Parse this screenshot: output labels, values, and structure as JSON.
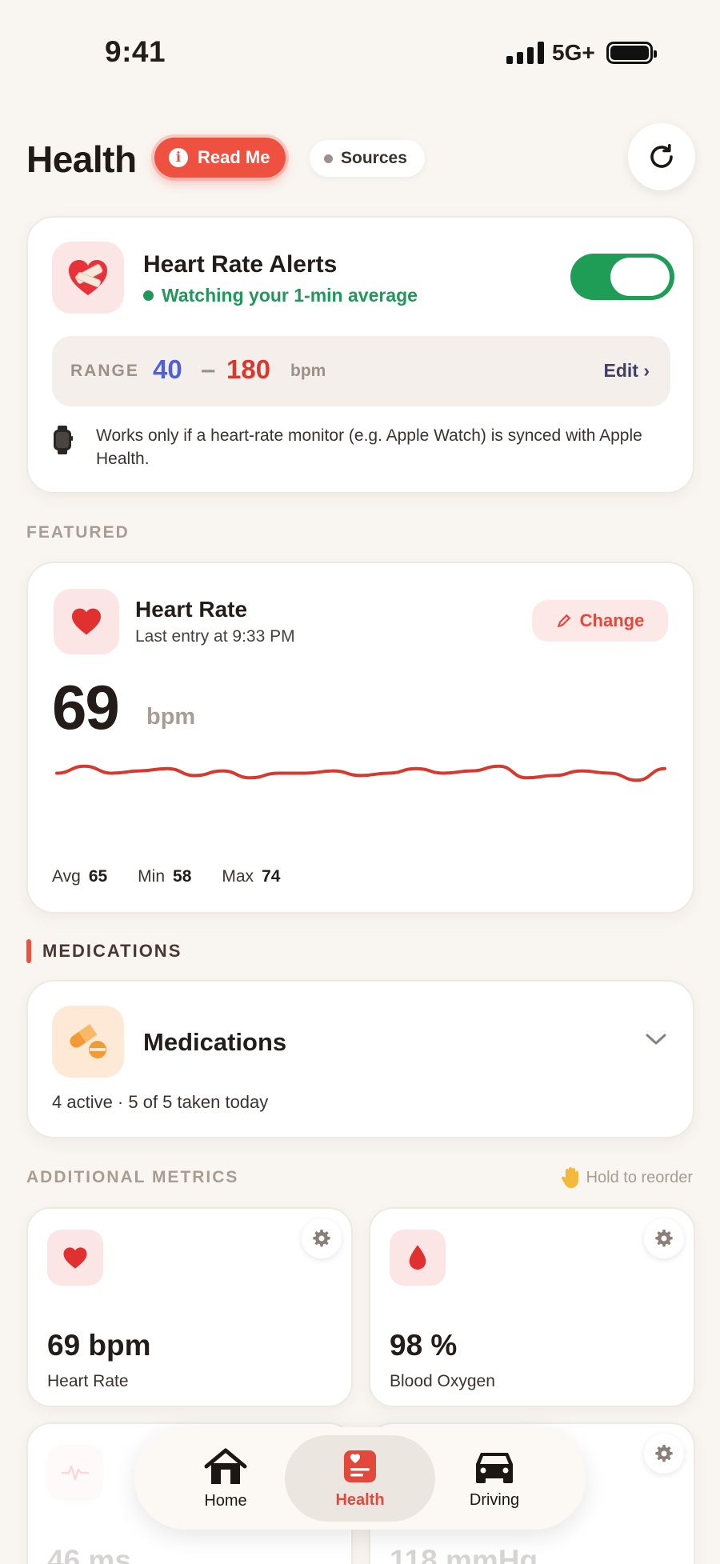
{
  "status_bar": {
    "time": "9:41",
    "network": "5G+"
  },
  "header": {
    "title": "Health",
    "readme_label": "Read Me",
    "sources_label": "Sources"
  },
  "alerts": {
    "title": "Heart Rate Alerts",
    "status": "Watching your 1-min average",
    "enabled": true,
    "range_label": "RANGE",
    "range_min": "40",
    "range_separator": "–",
    "range_max": "180",
    "range_unit": "bpm",
    "edit_label": "Edit ›",
    "note": "Works only if a heart-rate monitor (e.g. Apple Watch) is synced with Apple Health."
  },
  "featured": {
    "section_label": "FEATURED",
    "title": "Heart Rate",
    "subtitle": "Last entry at 9:33 PM",
    "change_label": "Change",
    "value": "69",
    "unit": "bpm",
    "trend": [
      66,
      69,
      66,
      67,
      68,
      65,
      67,
      64,
      66,
      66,
      67,
      65,
      66,
      68,
      66,
      67,
      69,
      64,
      65,
      67,
      66,
      63,
      68
    ],
    "stats": [
      {
        "label": "Avg",
        "value": "65"
      },
      {
        "label": "Min",
        "value": "58"
      },
      {
        "label": "Max",
        "value": "74"
      }
    ],
    "accent": "#d7392e"
  },
  "medications": {
    "section_label": "MEDICATIONS",
    "title": "Medications",
    "summary": "4 active · 5 of 5 taken today"
  },
  "additional": {
    "section_label": "ADDITIONAL METRICS",
    "reorder_hint": "Hold to reorder",
    "metrics": [
      {
        "value": "69 bpm",
        "name": "Heart Rate",
        "icon": "heart-icon"
      },
      {
        "value": "98 %",
        "name": "Blood Oxygen",
        "icon": "blood-drop-icon"
      },
      {
        "value": "46 ms",
        "icon": "pulse-icon"
      },
      {
        "value": "118 mmHg",
        "icon": "blood-pressure-icon"
      }
    ]
  },
  "nav": {
    "items": [
      {
        "label": "Home",
        "icon": "home-icon"
      },
      {
        "label": "Health",
        "icon": "health-card-icon",
        "active": true
      },
      {
        "label": "Driving",
        "icon": "car-icon"
      }
    ]
  }
}
